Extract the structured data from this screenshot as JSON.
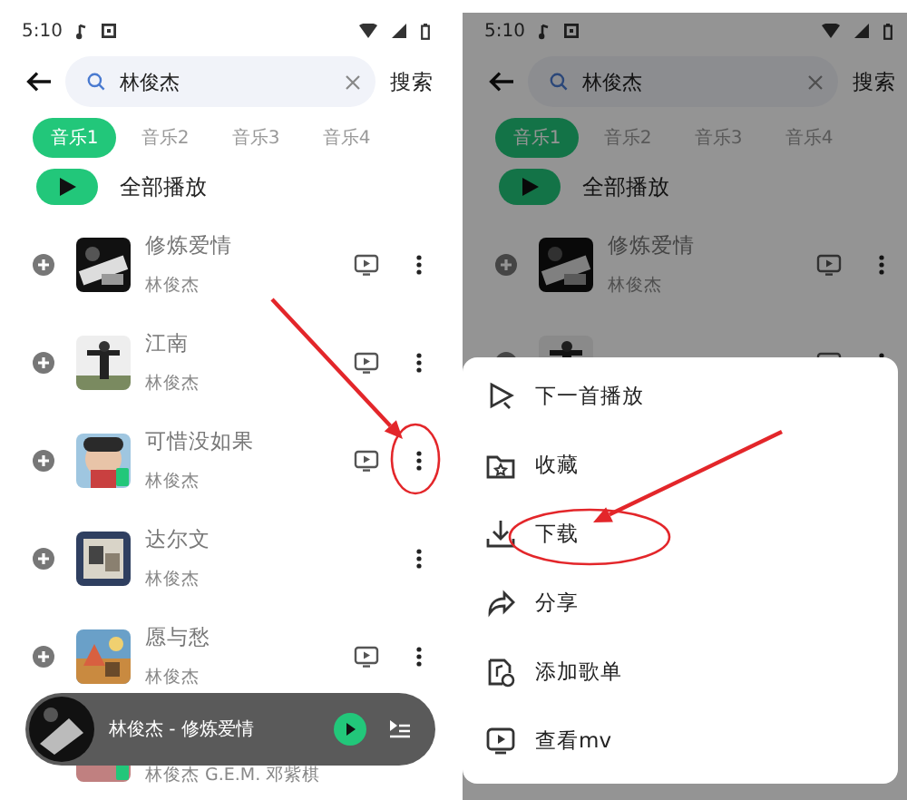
{
  "phones": [
    {
      "dimmed": false,
      "status_time": "5:10",
      "search": {
        "value": "林俊杰"
      },
      "search_button": "搜索",
      "tabs": [
        {
          "label": "音乐1",
          "selected": true
        },
        {
          "label": "音乐2",
          "selected": false
        },
        {
          "label": "音乐3",
          "selected": false
        },
        {
          "label": "音乐4",
          "selected": false
        }
      ],
      "play_all": "全部播放",
      "songs": [
        {
          "title": "修炼爱情",
          "artist": "林俊杰",
          "has_mv": true
        },
        {
          "title": "江南",
          "artist": "林俊杰",
          "has_mv": true
        },
        {
          "title": "可惜没如果",
          "artist": "林俊杰",
          "has_mv": true
        },
        {
          "title": "达尔文",
          "artist": "林俊杰",
          "has_mv": false
        },
        {
          "title": "愿与愁",
          "artist": "林俊杰",
          "has_mv": true
        },
        {
          "artist": "林俊杰 G.E.M. 邓紫棋"
        }
      ],
      "player": {
        "track": "林俊杰 - 修炼爱情"
      },
      "annotations": [
        {
          "kind": "arrow"
        },
        {
          "kind": "ellipse"
        }
      ]
    },
    {
      "dimmed": true,
      "status_time": "5:10",
      "search": {
        "value": "林俊杰"
      },
      "search_button": "搜索",
      "tabs": [
        {
          "label": "音乐1",
          "selected": true
        },
        {
          "label": "音乐2",
          "selected": false
        },
        {
          "label": "音乐3",
          "selected": false
        },
        {
          "label": "音乐4",
          "selected": false
        }
      ],
      "play_all": "全部播放",
      "songs": [
        {
          "title": "修炼爱情",
          "artist": "林俊杰",
          "has_mv": true
        },
        {
          "has_mv": true
        }
      ],
      "menu": [
        "下一首播放",
        "收藏",
        "下载",
        "分享",
        "添加歌单",
        "查看mv"
      ],
      "annotations": [
        {
          "kind": "arrow"
        },
        {
          "kind": "ellipse"
        }
      ]
    }
  ]
}
